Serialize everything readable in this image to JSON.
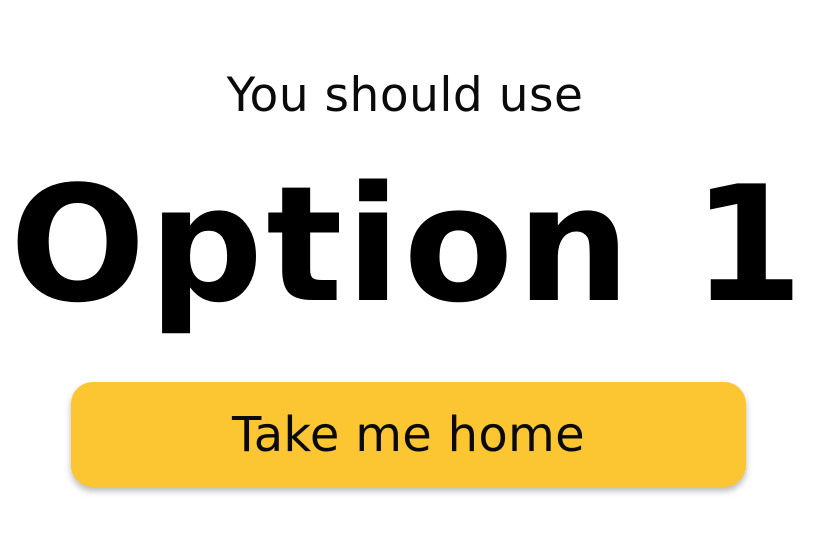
{
  "result_screen": {
    "subtitle": "You should use",
    "choice": "Option 1",
    "home_button_label": "Take me home"
  },
  "colors": {
    "background": "#ffffff",
    "button_fill": "#fbc631",
    "text": "#000000"
  }
}
